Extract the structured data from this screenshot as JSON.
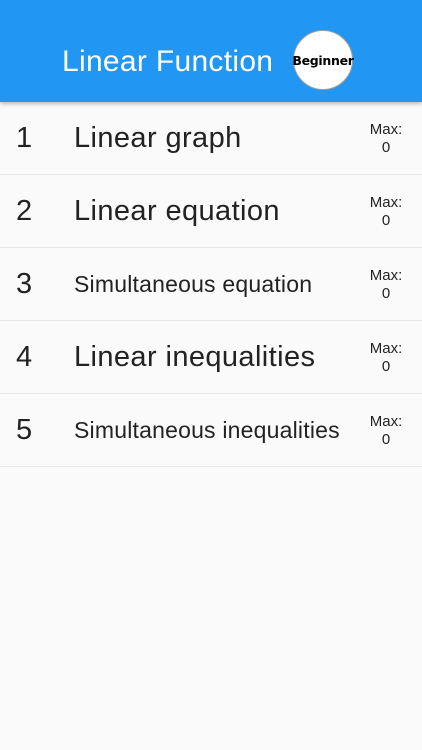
{
  "app_bar": {
    "title": "Linear Function",
    "level_badge": "Beginner",
    "color": "#2196f3"
  },
  "rows": [
    {
      "number": "1",
      "label": "Linear graph",
      "max_label": "Max:",
      "max_value": "0"
    },
    {
      "number": "2",
      "label": "Linear equation",
      "max_label": "Max:",
      "max_value": "0"
    },
    {
      "number": "3",
      "label": "Simultaneous equation",
      "max_label": "Max:",
      "max_value": "0"
    },
    {
      "number": "4",
      "label": "Linear inequalities",
      "max_label": "Max:",
      "max_value": "0"
    },
    {
      "number": "5",
      "label": "Simultaneous inequalities",
      "max_label": "Max:",
      "max_value": "0"
    }
  ]
}
